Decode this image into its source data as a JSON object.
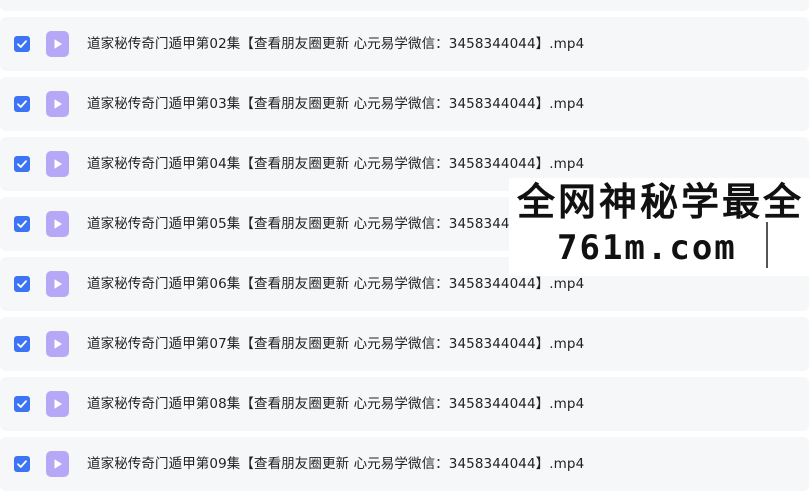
{
  "file_list": {
    "items": [
      {
        "name": "",
        "checked": true
      },
      {
        "name": "道家秘传奇门遁甲第02集【查看朋友圈更新 心元易学微信：3458344044】.mp4",
        "checked": true
      },
      {
        "name": "道家秘传奇门遁甲第03集【查看朋友圈更新 心元易学微信：3458344044】.mp4",
        "checked": true
      },
      {
        "name": "道家秘传奇门遁甲第04集【查看朋友圈更新 心元易学微信：3458344044】.mp4",
        "checked": true
      },
      {
        "name": "道家秘传奇门遁甲第05集【查看朋友圈更新 心元易学微信：3458344044】.mp4",
        "checked": true
      },
      {
        "name": "道家秘传奇门遁甲第06集【查看朋友圈更新 心元易学微信：3458344044】.mp4",
        "checked": true
      },
      {
        "name": "道家秘传奇门遁甲第07集【查看朋友圈更新 心元易学微信：3458344044】.mp4",
        "checked": true
      },
      {
        "name": "道家秘传奇门遁甲第08集【查看朋友圈更新 心元易学微信：3458344044】.mp4",
        "checked": true
      },
      {
        "name": "道家秘传奇门遁甲第09集【查看朋友圈更新 心元易学微信：3458344044】.mp4",
        "checked": true
      }
    ]
  },
  "watermark": {
    "line1": "全网神秘学最全",
    "line2": "761m.com"
  },
  "icons": {
    "checkbox": "checkmark-icon",
    "file": "video-play-icon"
  },
  "colors": {
    "accent": "#3d74f5",
    "video_icon": "#b6a8f7",
    "row_background": "#f6f7f9"
  }
}
